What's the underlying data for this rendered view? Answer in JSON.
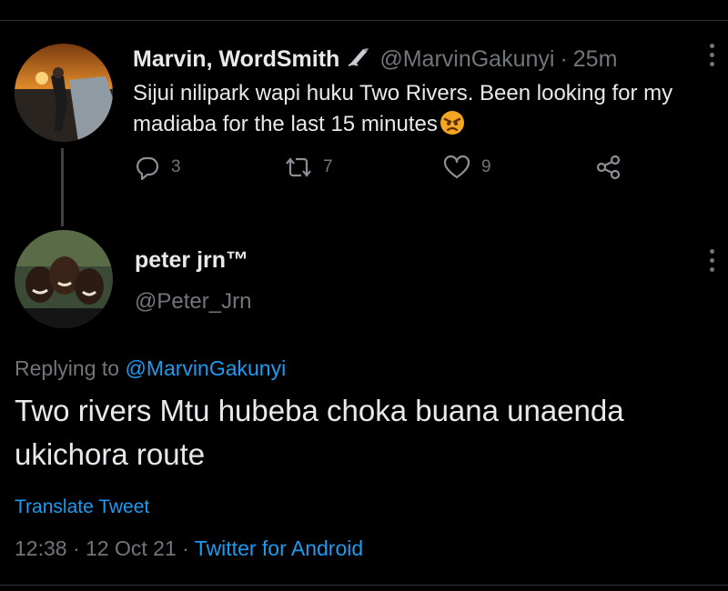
{
  "tweet": {
    "author_name": "Marvin, WordSmith",
    "author_handle": "@MarvinGakunyi",
    "separator": "·",
    "time_ago": "25m",
    "text": "Sijui nilipark wapi huku Two Rivers. Been looking for my madiaba for the last 15 minutes",
    "emoji": "angry-face-icon",
    "name_badge_icon": "writing-hand-icon",
    "stats": {
      "replies": "3",
      "retweets": "7",
      "likes": "9"
    }
  },
  "reply": {
    "author_name": "peter jrn™",
    "author_handle": "@Peter_Jrn",
    "replying_prefix": "Replying to",
    "replying_to": "@MarvinGakunyi",
    "text": "Two rivers Mtu hubeba choka buana unaenda ukichora route",
    "translate_label": "Translate Tweet",
    "time": "12:38",
    "date": "12 Oct 21",
    "separator": "·",
    "client": "Twitter for Android"
  },
  "colors": {
    "background": "#000000",
    "text_primary": "#e7e9ea",
    "text_secondary": "#71767b",
    "accent": "#1d9bf0"
  }
}
